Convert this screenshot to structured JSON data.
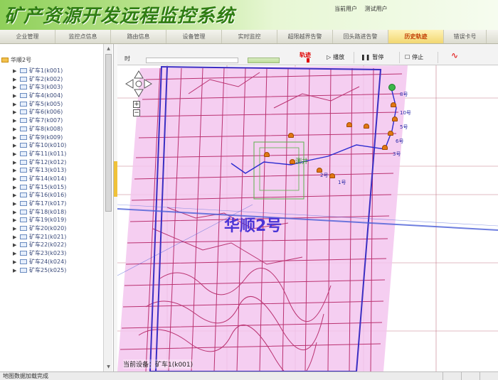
{
  "header": {
    "title": "矿产资源开发远程监控系统",
    "current_user_label": "当前用户",
    "current_user": "测试用户"
  },
  "nav": {
    "tabs": [
      "企业管理",
      "监控点信息",
      "路由信息",
      "设备管理",
      "实时监控",
      "超限越界告警",
      "回头路进告警",
      "历史轨迹",
      "错误卡号"
    ],
    "active": "历史轨迹"
  },
  "tree": {
    "root": "华顺2号",
    "items": [
      "矿车1(k001)",
      "矿车2(k002)",
      "矿车3(k003)",
      "矿车4(k004)",
      "矿车5(k005)",
      "矿车6(k006)",
      "矿车7(k007)",
      "矿车8(k008)",
      "矿车9(k009)",
      "矿车10(k010)",
      "矿车11(k011)",
      "矿车12(k012)",
      "矿车13(k013)",
      "矿车14(k014)",
      "矿车15(k015)",
      "矿车16(k016)",
      "矿车17(k017)",
      "矿车18(k018)",
      "矿车19(k019)",
      "矿车20(k020)",
      "矿车21(k021)",
      "矿车22(k022)",
      "矿车23(k023)",
      "矿车24(k024)",
      "矿车25(k025)"
    ]
  },
  "toolbar": {
    "time_label": "时",
    "track_title": "轨迹",
    "play": "播放",
    "pause": "暂停",
    "stop": "停止",
    "play_icon": "play-icon",
    "pause_icon": "pause-icon",
    "stop_icon": "stop-icon",
    "chart_icon": "line-chart-icon"
  },
  "map": {
    "area_label": "华顺2号",
    "current_device": "当前设备：矿车1(k001)",
    "poi_labels": [
      "8号",
      "10号",
      "5号",
      "6号",
      "3号",
      "测井",
      "2号",
      "1号"
    ],
    "accent": "#4b34d6",
    "overlay_color": "#f3c6ef",
    "road_color": "#b0175b",
    "track_color": "#2b2bd0"
  },
  "status": {
    "text": "地图数据加载完成"
  },
  "colors": {
    "header_green": "#2f7d13",
    "active_tab": "#f2d771",
    "track_red": "#e00000"
  }
}
